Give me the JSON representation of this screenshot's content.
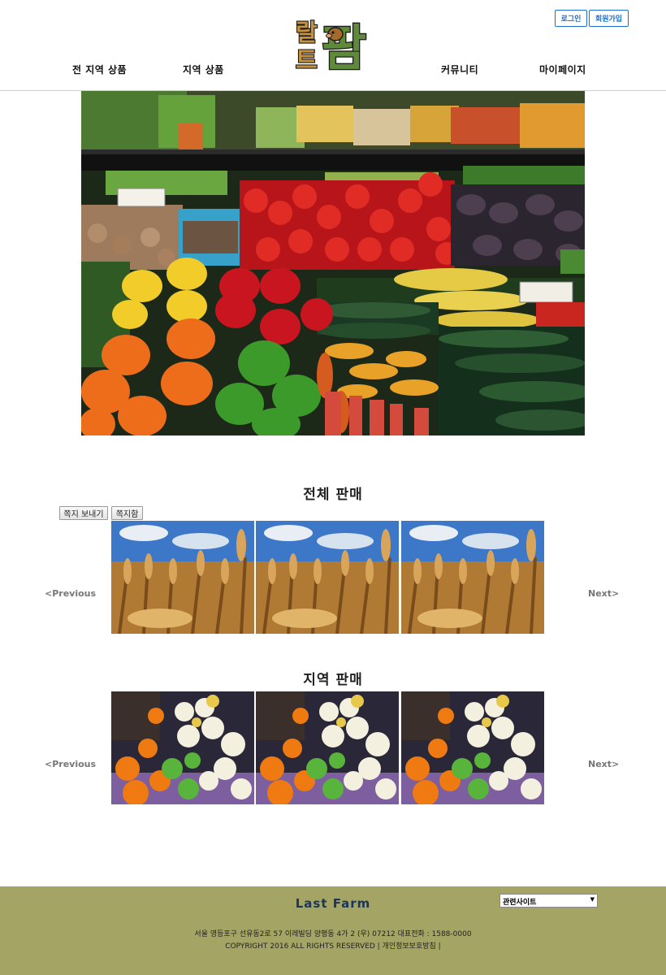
{
  "header": {
    "login_label": "로그인",
    "signup_label": "회원가입",
    "logo_text_left_top": "랄",
    "logo_text_left_bottom": "트",
    "logo_text_right": "팜",
    "nav": [
      "전 지역 상품",
      "지역 상품",
      "커뮤니티",
      "마이페이지"
    ]
  },
  "sections": {
    "all_sales_title": "전체 판매",
    "local_sales_title": "지역 판매",
    "send_note_label": "쪽지 보내기",
    "note_box_label": "쪽지함",
    "previous_label": "<Previous",
    "next_label": "Next>"
  },
  "footer": {
    "brand": "Last Farm",
    "address": "서울 영등포구 선유동2로 57 이레빌딩 양평동 4가 2 (우) 07212 대표전화 : 1588-0000",
    "copyright": "COPYRIGHT 2016 ALL RIGHTS RESERVED | 개인정보보호방침 |",
    "related_sites_selected": "관련사이트"
  },
  "colors": {
    "footer_bg": "#a4a465",
    "auth_button": "#1a6fd0",
    "brand_text": "#1c3558"
  }
}
